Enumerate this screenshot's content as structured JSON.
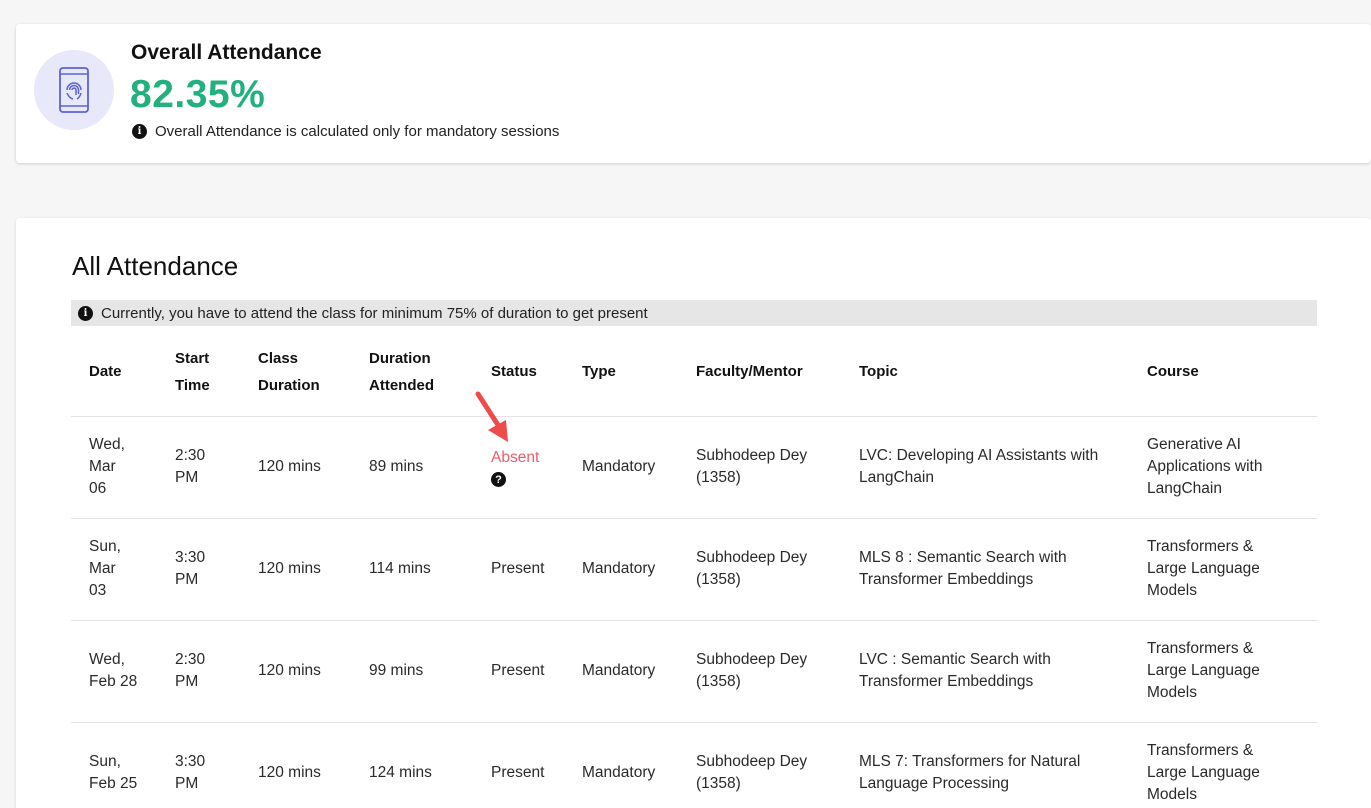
{
  "summary": {
    "title": "Overall Attendance",
    "percent": "82.35%",
    "note": "Overall Attendance is calculated only for mandatory sessions",
    "icon": "phone-fingerprint-icon"
  },
  "main": {
    "title": "All Attendance",
    "notice": "Currently, you have to attend the class for minimum 75% of duration to get present"
  },
  "table": {
    "headers": {
      "date": "Date",
      "start_1": "Start",
      "start_2": "Time",
      "class_1": "Class",
      "class_2": "Duration",
      "dur_1": "Duration",
      "dur_2": "Attended",
      "status": "Status",
      "type": "Type",
      "faculty": "Faculty/Mentor",
      "topic": "Topic",
      "course": "Course"
    },
    "rows": [
      {
        "date_1": "Wed,",
        "date_2": "Mar",
        "date_3": "06",
        "time_1": "2:30",
        "time_2": "PM",
        "class_duration": "120 mins",
        "attended": "89 mins",
        "status": "Absent",
        "status_help": "?",
        "type": "Mandatory",
        "faculty_1": "Subhodeep Dey",
        "faculty_2": "(1358)",
        "topic_1": "LVC: Developing AI Assistants with",
        "topic_2": "LangChain",
        "course_1": "Generative AI",
        "course_2": "Applications with",
        "course_3": "LangChain"
      },
      {
        "date_1": "Sun,",
        "date_2": "Mar",
        "date_3": "03",
        "time_1": "3:30",
        "time_2": "PM",
        "class_duration": "120 mins",
        "attended": "114 mins",
        "status": "Present",
        "type": "Mandatory",
        "faculty_1": "Subhodeep Dey",
        "faculty_2": "(1358)",
        "topic_1": "MLS 8 : Semantic Search with",
        "topic_2": "Transformer Embeddings",
        "course_1": "Transformers &",
        "course_2": "Large Language",
        "course_3": "Models"
      },
      {
        "date_1": "Wed,",
        "date_2": "Feb 28",
        "time_1": "2:30",
        "time_2": "PM",
        "class_duration": "120 mins",
        "attended": "99 mins",
        "status": "Present",
        "type": "Mandatory",
        "faculty_1": "Subhodeep Dey",
        "faculty_2": "(1358)",
        "topic_1": "LVC : Semantic Search with",
        "topic_2": "Transformer Embeddings",
        "course_1": "Transformers &",
        "course_2": "Large Language",
        "course_3": "Models"
      },
      {
        "date_1": "Sun,",
        "date_2": "Feb 25",
        "time_1": "3:30",
        "time_2": "PM",
        "class_duration": "120 mins",
        "attended": "124 mins",
        "status": "Present",
        "type": "Mandatory",
        "faculty_1": "Subhodeep Dey",
        "faculty_2": "(1358)",
        "topic_1": "MLS 7: Transformers for Natural",
        "topic_2": "Language Processing",
        "course_1": "Transformers &",
        "course_2": "Large Language",
        "course_3": "Models"
      }
    ]
  },
  "colors": {
    "accent_green": "#22b07d",
    "absent_red": "#ee5a6a",
    "annotation_arrow": "#ee4b4b",
    "icon_purple": "#5b63d6"
  }
}
